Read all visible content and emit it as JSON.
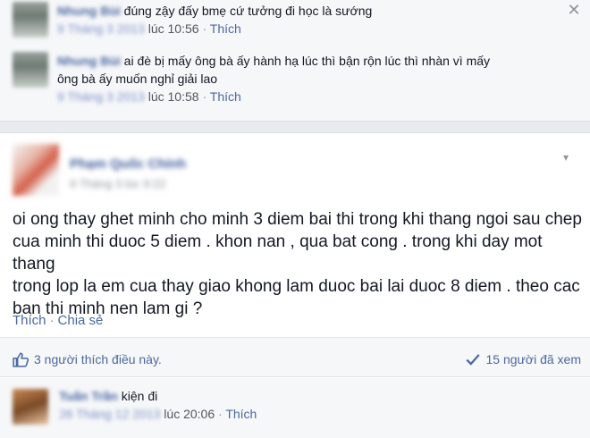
{
  "comments": [
    {
      "author": "Nhung Bùi",
      "text": "đúng zậy đấy bmẹ cứ tưởng đi học là sướng",
      "date": "9 Tháng 3 2013",
      "time_suffix": "lúc 10:56",
      "like_label": "Thích"
    },
    {
      "author": "Nhung Bùi",
      "text_line1": "ai đè bị mấy ông bà ấy hành hạ lúc thì bận rộn lúc thì nhàn vì mấy",
      "text_line2": "ông bà ấy muốn nghỉ giải lao",
      "date": "9 Tháng 3 2013",
      "time_suffix": "lúc 10:58",
      "like_label": "Thích"
    }
  ],
  "close_icon": "close-icon",
  "post": {
    "author": "Phạm Quốc Chính",
    "date": "9 Tháng 3 lúc 9:22",
    "text_lines": [
      "oi ong thay ghet minh cho minh 3 diem bai thi trong khi thang ngoi sau chep",
      "cua minh thi duoc 5 diem . khon nan , qua bat cong . trong khi day mot thang",
      "trong lop la em cua thay giao khong lam duoc bai lai duoc 8 diem . theo cac",
      "ban thi minh nen lam gi ?"
    ],
    "like_label": "Thích",
    "share_label": "Chia sẻ",
    "separator": "·",
    "likes_text": "3 người thích điều này.",
    "seen_text": "15 người đã xem"
  },
  "reply": {
    "author": "Tuấn Trần",
    "text": "kiện đi",
    "date": "26 Tháng 12 2013",
    "time_suffix": "lúc 20:06",
    "like_label": "Thích"
  },
  "colors": {
    "link": "#4b67a1",
    "background": "#e9ebee",
    "comment_bg": "#f6f7f9"
  }
}
